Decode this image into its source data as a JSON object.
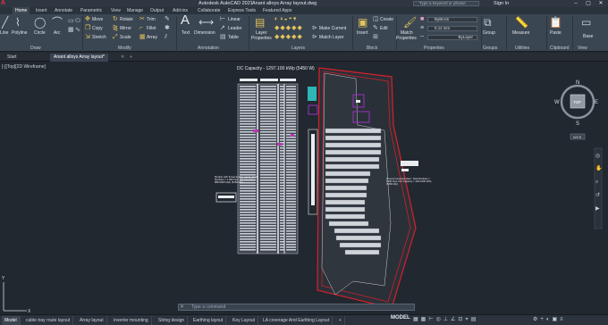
{
  "titlebar": {
    "app_title": "Autodesk AutoCAD 2021",
    "doc_title": "Anant alloys Array layout.dwg",
    "search_placeholder": "Type a keyword or phrase",
    "signin": "Sign In"
  },
  "ribbon_tabs": [
    "Home",
    "Insert",
    "Annotate",
    "Parametric",
    "View",
    "Manage",
    "Output",
    "Add-ins",
    "Collaborate",
    "Express Tools",
    "Featured Apps"
  ],
  "draw_panel": {
    "title": "Draw",
    "tools": [
      "Line",
      "Polyline",
      "Circle",
      "Arc"
    ]
  },
  "modify_panel": {
    "title": "Modify",
    "tools": [
      "Move",
      "Rotate",
      "Trim",
      "Copy",
      "Mirror",
      "Fillet",
      "Stretch",
      "Scale",
      "Array"
    ]
  },
  "annotation_panel": {
    "title": "Annotation",
    "tools": [
      "Text",
      "Dimension",
      "Linear",
      "Leader",
      "Table"
    ]
  },
  "layers_panel": {
    "title": "Layers",
    "tools": [
      "Layer Properties",
      "Make Current",
      "Match Layer"
    ]
  },
  "block_panel": {
    "title": "Block",
    "tools": [
      "Insert",
      "Create",
      "Edit"
    ]
  },
  "properties_panel": {
    "title": "Properties",
    "match_label": "Match Properties",
    "color_value": "ByBlock",
    "lineweight_value": "0.11 mm",
    "linetype_value": "ByLayer"
  },
  "groups_panel": {
    "label": "Group",
    "title": "Groups"
  },
  "utilities_panel": {
    "label": "Measure",
    "title": "Utilities"
  },
  "clipboard_panel": {
    "label": "Paste",
    "title": "Clipboard"
  },
  "view_panel": {
    "label": "Base",
    "title": "View"
  },
  "file_tabs": [
    "Start",
    "Anant alloys Array layout*"
  ],
  "viewport_label": "[-][Top][2D Wireframe]",
  "drawing": {
    "capacity_title": "DC Capacity - 1297.100 kWp (5450 W)",
    "left_note": "Module with threat details, stand. Total Modules = 1 960 Nos. DC Capacity = 888.0000 kWp (5450 Wp)",
    "right_note": "Ground mounted plant. Total Modules = 1260 Nos. DC Capacity = 409.1000 kWp (5450 Wp)"
  },
  "viewcube": {
    "top": "TOP",
    "north": "N",
    "south": "S",
    "east": "E",
    "west": "W",
    "wcs": "WCS"
  },
  "command_placeholder": "Type a command",
  "layout_tabs": [
    "Model",
    "cable tray route layout",
    "Array layout",
    "inverter mounting",
    "String design",
    "Earthing layout",
    "Key Layout",
    "LA coverage And Earthing Layout"
  ],
  "status": {
    "mode": "MODEL"
  },
  "colors": {
    "boundary_red": "#d11f2a",
    "panel_purple": "#9b2fc0",
    "teal": "#2fb4b8"
  }
}
